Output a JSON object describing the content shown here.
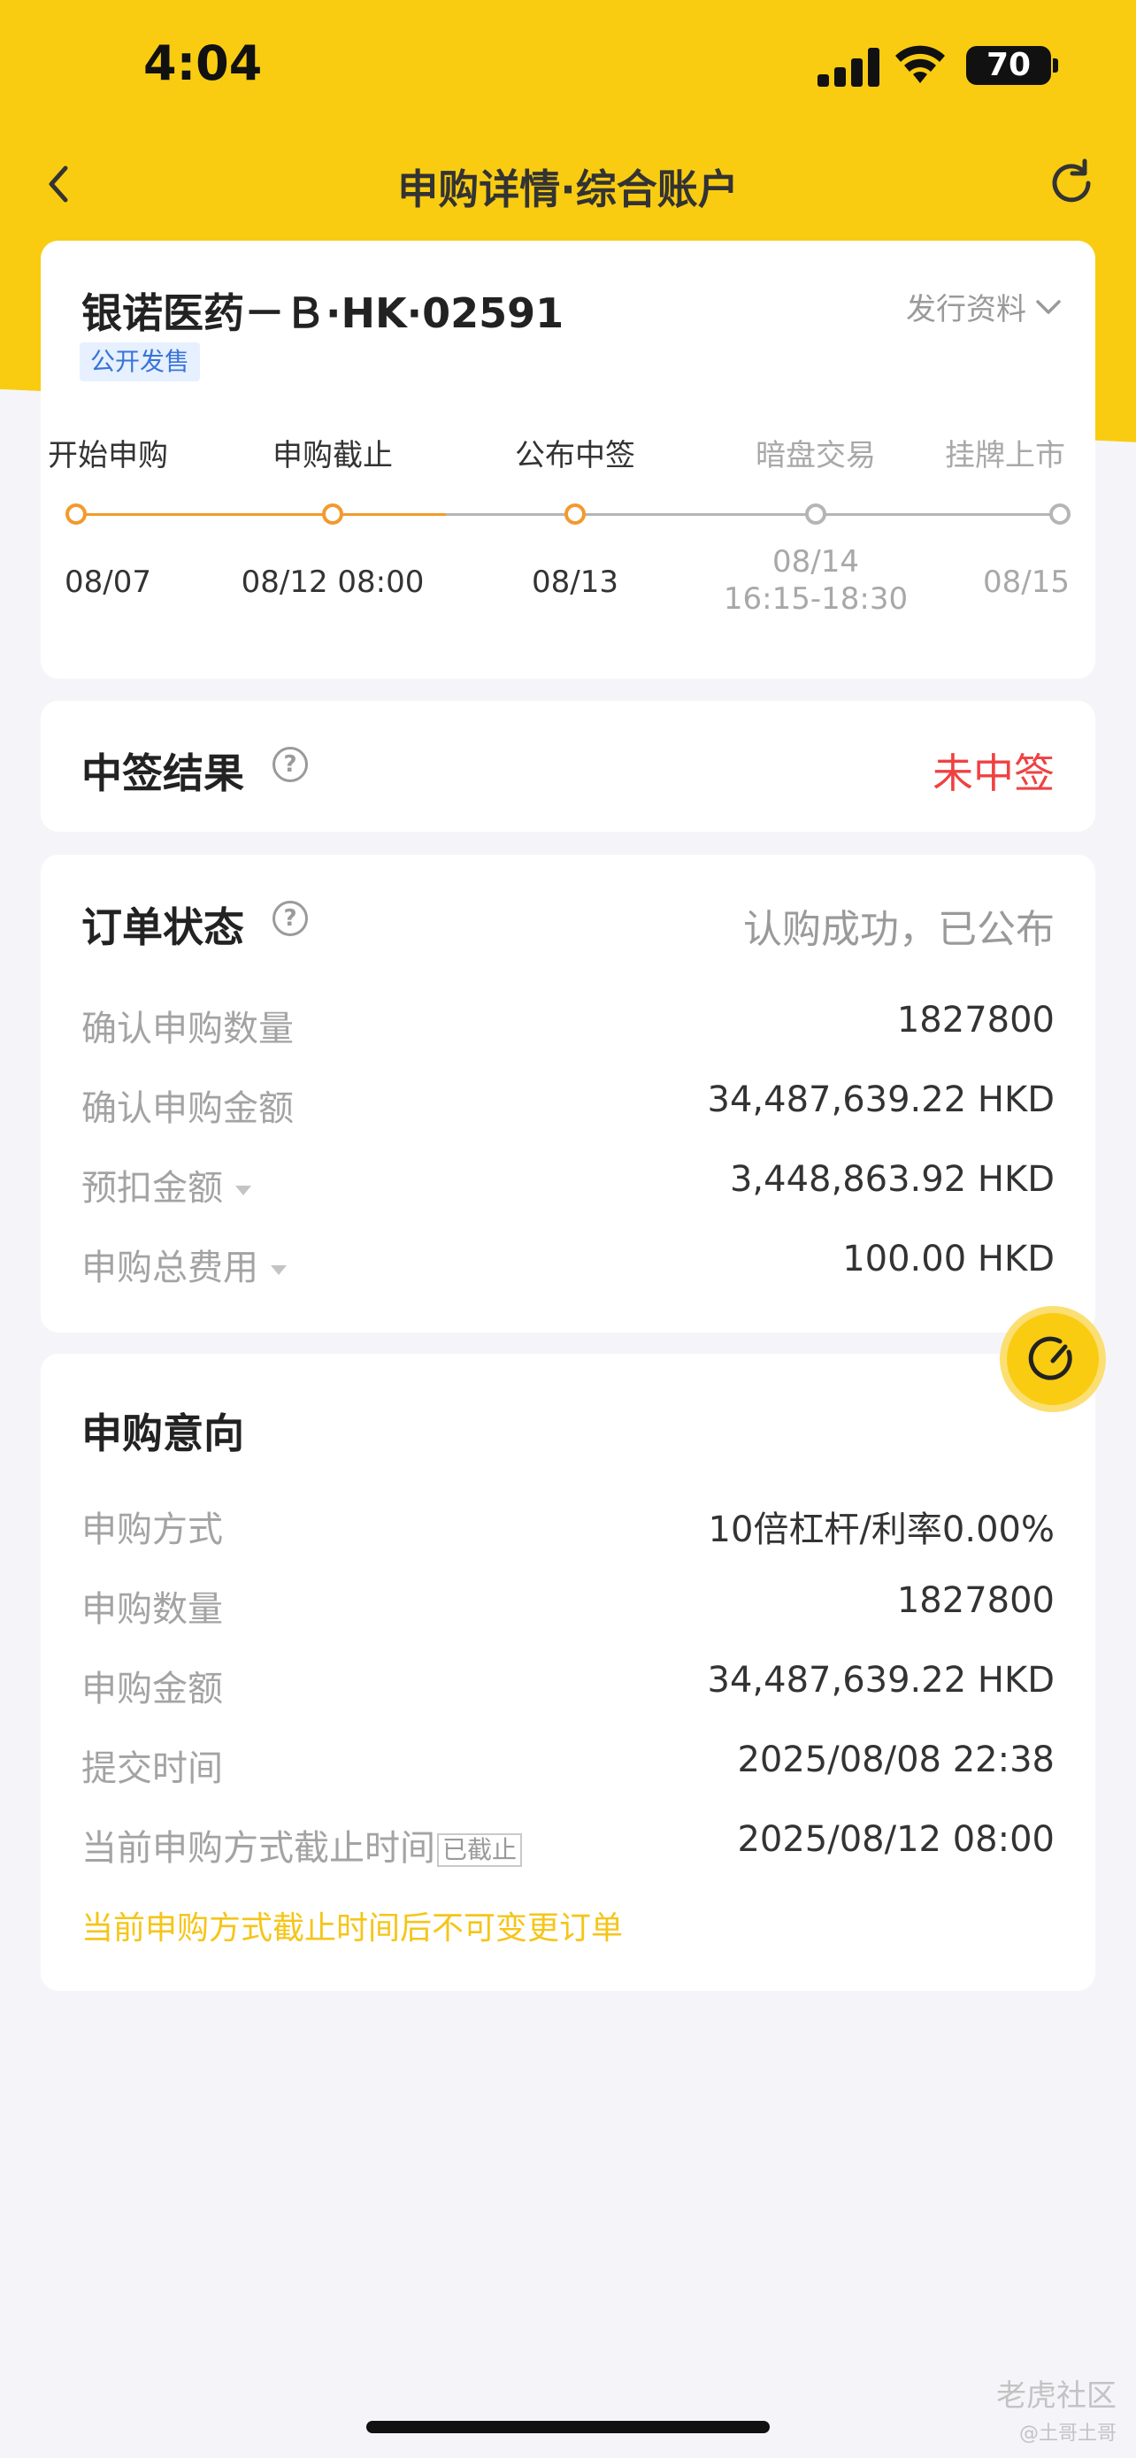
{
  "status_bar": {
    "time": "4:04",
    "battery": "70"
  },
  "nav": {
    "title": "申购详情·综合账户"
  },
  "stock": {
    "name": "银诺医药－Ｂ·HK·02591",
    "tag": "公开发售",
    "issue_info": "发行资料",
    "timeline": [
      {
        "label": "开始申购",
        "date": "08/07",
        "state": "done"
      },
      {
        "label": "申购截止",
        "date": "08/12 08:00",
        "state": "done"
      },
      {
        "label": "公布中签",
        "date": "08/13",
        "state": "done"
      },
      {
        "label": "暗盘交易",
        "date": "08/14\n16:15-18:30",
        "state": "pending"
      },
      {
        "label": "挂牌上市",
        "date": "08/15",
        "state": "pending"
      }
    ]
  },
  "result": {
    "title": "中签结果",
    "value": "未中签"
  },
  "order": {
    "title": "订单状态",
    "status": "认购成功，已公布",
    "rows": [
      {
        "label": "确认申购数量",
        "value": "1827800"
      },
      {
        "label": "确认申购金额",
        "value": "34,487,639.22 HKD"
      },
      {
        "label": "预扣金额",
        "value": "3,448,863.92 HKD"
      },
      {
        "label": "申购总费用",
        "value": "100.00 HKD"
      }
    ]
  },
  "intention": {
    "title": "申购意向",
    "rows": [
      {
        "label": "申购方式",
        "value": "10倍杠杆/利率0.00%"
      },
      {
        "label": "申购数量",
        "value": "1827800"
      },
      {
        "label": "申购金额",
        "value": "34,487,639.22 HKD"
      },
      {
        "label": "提交时间",
        "value": "2025/08/08 22:38"
      },
      {
        "label": "当前申购方式截止时间",
        "value": "2025/08/12 08:00"
      }
    ],
    "closed_tag": "已截止",
    "note": "当前申购方式截止时间后不可变更订单"
  },
  "watermark": {
    "brand": "老虎社区",
    "user": "@土哥土哥"
  },
  "colors": {
    "brand_yellow": "#f9cc12",
    "timeline_active": "#f29a2e",
    "timeline_pending": "#b5b5b5",
    "result_red": "#f04141"
  }
}
